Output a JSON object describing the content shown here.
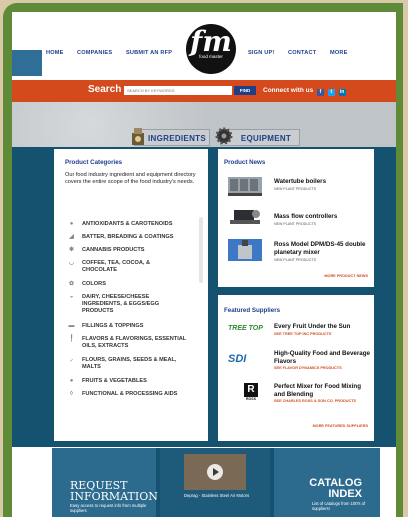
{
  "nav": {
    "left": [
      "HOME",
      "COMPANIES",
      "SUBMIT AN RFP"
    ],
    "right": [
      "SIGN UP!",
      "CONTACT",
      "MORE"
    ]
  },
  "logo": {
    "mark": "fm",
    "tag": "food master"
  },
  "search": {
    "label": "Search",
    "placeholder": "SEARCH BY KEYWORDS",
    "button": "FIND",
    "connect": "Connect with us"
  },
  "social": [
    "f",
    "t",
    "in"
  ],
  "categories_nav": {
    "ingredients": "INGREDIENTS",
    "equipment": "EQUIPMENT"
  },
  "product_categories": {
    "title": "Product Categories",
    "description": "Our food industry ingredient and equipment directory covers the entire scope of the food industry's needs.",
    "items": [
      "ANTIOXIDANTS & CAROTENOIDS",
      "BATTER, BREADING & COATINGS",
      "CANNABIS PRODUCTS",
      "COFFEE, TEA, COCOA, & CHOCOLATE",
      "COLORS",
      "DAIRY, CHEESE/CHEESE INGREDIENTS, & EGGS/EGG PRODUCTS",
      "FILLINGS & TOPPINGS",
      "FLAVORS & FLAVORINGS, ESSENTIAL OILS, EXTRACTS",
      "FLOURS, GRAINS, SEEDS & MEAL, MALTS",
      "FRUITS & VEGETABLES",
      "FUNCTIONAL & PROCESSING AIDS"
    ]
  },
  "product_news": {
    "title": "Product News",
    "items": [
      {
        "name": "Watertube boilers",
        "tag": "NEW PLANT PRODUCTS"
      },
      {
        "name": "Mass flow controllers",
        "tag": "NEW PLANT PRODUCTS"
      },
      {
        "name": "Ross Model DPM/DS-45 double planetary mixer",
        "tag": "NEW PLANT PRODUCTS"
      }
    ],
    "more": "MORE PRODUCT NEWS"
  },
  "featured_suppliers": {
    "title": "Featured Suppliers",
    "items": [
      {
        "logo": "TREE TOP",
        "name": "Every Fruit Under the Sun",
        "link": "SEE TREE TOP INC PRODUCTS"
      },
      {
        "logo": "SDI",
        "name": "High-Quality Food and Beverage Flavors",
        "link": "SEE FLAVOR DYNAMICS PRODUCTS"
      },
      {
        "logo": "ROSS",
        "name": "Perfect Mixer for Food Mixing and Blending",
        "link": "SEE CHARLES ROSS & SON CO. PRODUCTS"
      }
    ],
    "more": "MORE FEATURED SUPPLIERS"
  },
  "bottom": {
    "request": {
      "title1": "REQUEST",
      "title2": "INFORMATION",
      "sub": "Easy access to request info from multiple suppliers"
    },
    "video": {
      "caption": "Deprag - Stainless Steel Air Motors"
    },
    "catalog": {
      "title1": "CATALOG",
      "title2": "INDEX",
      "sub": "List of catalogs from 100's of suppliers!"
    }
  },
  "colors": {
    "accent_orange": "#d44a1c",
    "navy": "#1d3f8a",
    "teal": "#145270",
    "frame_green": "#5f8a37"
  }
}
